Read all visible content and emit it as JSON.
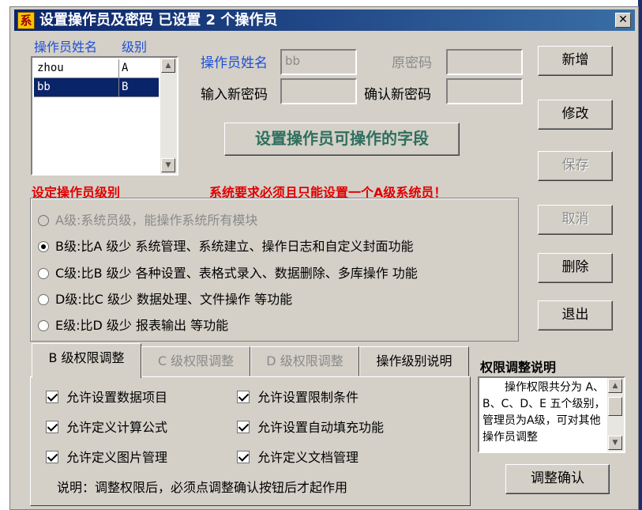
{
  "window": {
    "title": "设置操作员及密码 已设置 2 个操作员",
    "icon_glyph": "系",
    "close_glyph": "✕"
  },
  "operator_list": {
    "col_name_header": "操作员姓名",
    "col_level_header": "级别",
    "rows": [
      {
        "name": "zhou",
        "level": "A"
      },
      {
        "name": "bb",
        "level": "B"
      }
    ],
    "selected_index": 1
  },
  "form": {
    "operator_name_label": "操作员姓名",
    "operator_name_value": "bb",
    "old_password_label": "原密码",
    "new_password_label": "输入新密码",
    "confirm_password_label": "确认新密码"
  },
  "set_fields_button": "设置操作员可操作的字段",
  "buttons": {
    "add": "新增",
    "modify": "修改",
    "save": "保存",
    "cancel": "取消",
    "delete": "删除",
    "exit": "退出",
    "confirm_adjust": "调整确认"
  },
  "level_section": {
    "title": "设定操作员级别",
    "warning": "系统要求必须且只能设置一个A级系统员！",
    "options": [
      {
        "label": "A级:系统员级，能操作系统所有模块",
        "checked": false,
        "disabled": true
      },
      {
        "label": "B级:比A 级少  系统管理、系统建立、操作日志和自定义封面功能",
        "checked": true,
        "disabled": false
      },
      {
        "label": "C级:比B 级少  各种设置、表格式录入、数据删除、多库操作  功能",
        "checked": false,
        "disabled": false
      },
      {
        "label": "D级:比C 级少  数据处理、文件操作  等功能",
        "checked": false,
        "disabled": false
      },
      {
        "label": "E级:比D 级少  报表输出  等功能",
        "checked": false,
        "disabled": false
      }
    ]
  },
  "tabs": [
    {
      "label": "B 级权限调整",
      "active": true
    },
    {
      "label": "C 级权限调整",
      "active": false
    },
    {
      "label": "D 级权限调整",
      "active": false
    },
    {
      "label": "操作级别说明",
      "active": false
    }
  ],
  "permissions": [
    {
      "label": "允许设置数据项目",
      "checked": true
    },
    {
      "label": "允许设置限制条件",
      "checked": true
    },
    {
      "label": "允许定义计算公式",
      "checked": true
    },
    {
      "label": "允许设置自动填充功能",
      "checked": true
    },
    {
      "label": "允许定义图片管理",
      "checked": true
    },
    {
      "label": "允许定义文档管理",
      "checked": true
    }
  ],
  "tab_note": "说明：调整权限后，必须点调整确认按钮后才起作用",
  "help": {
    "title": "权限调整说明",
    "text": "操作权限共分为 A、B、C、D、E 五个级别，管理员为A级，可对其他操作员调整"
  },
  "colors": {
    "title_bar_start": "#0a246a",
    "title_bar_end": "#3a6ea5",
    "window_face": "#d4d0c8",
    "label_blue": "#1f4fd6",
    "label_red": "#e00000",
    "accent_button_text": "#2e6f5e",
    "selection": "#0a246a"
  }
}
